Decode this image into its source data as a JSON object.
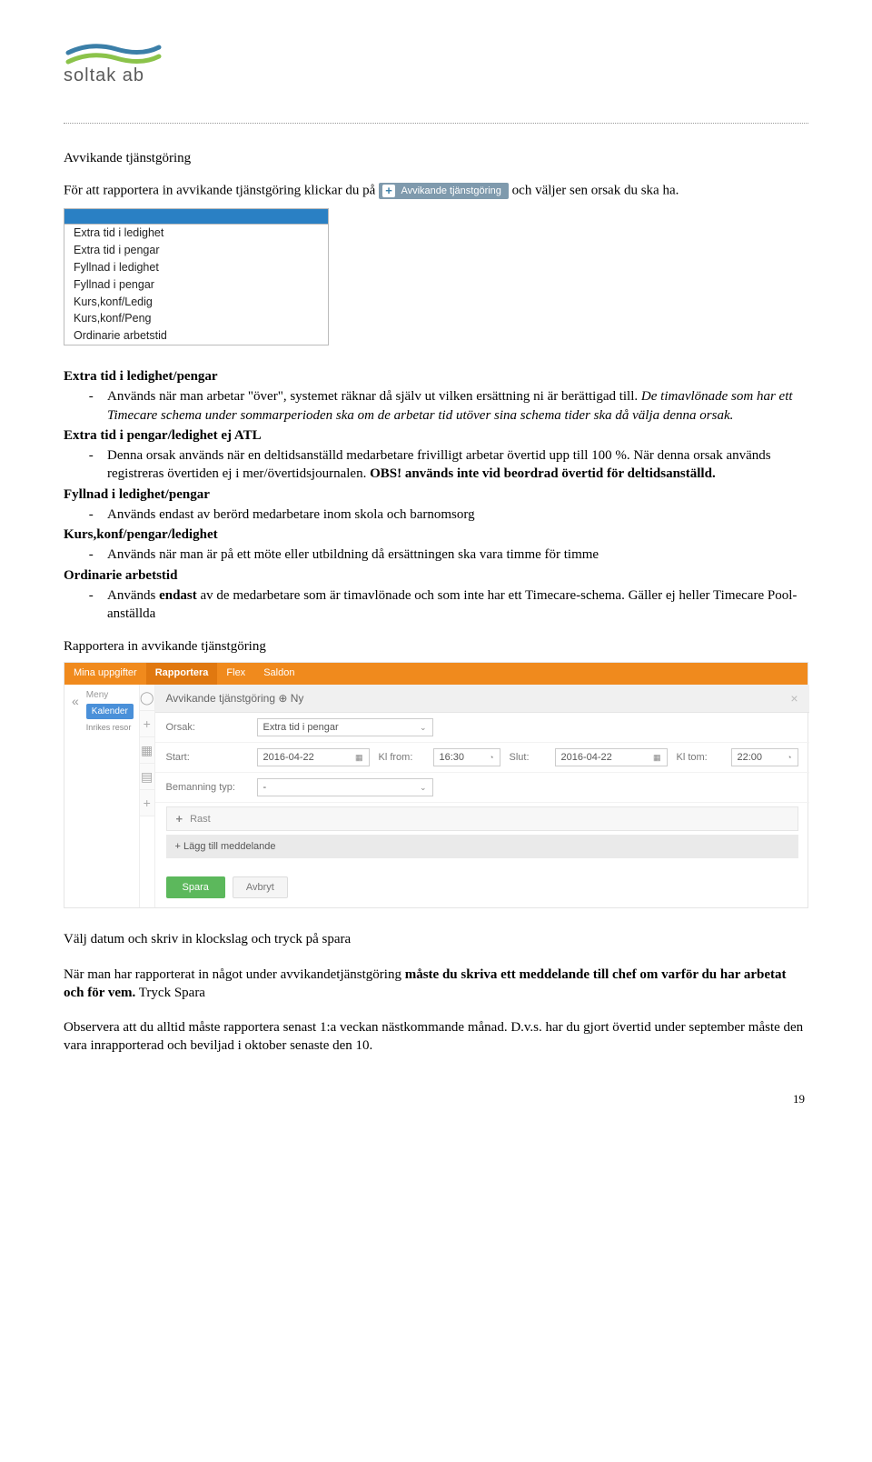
{
  "logo_text": "soltak ab",
  "title": "Avvikande tjänstgöring",
  "intro_prefix": "För att rapportera in avvikande tjänstgöring klickar du på ",
  "intro_suffix": " och väljer sen orsak du ska ha.",
  "badge_label": "Avvikande tjänstgöring",
  "dropdown_options": [
    "Extra tid i ledighet",
    "Extra tid i pengar",
    "Fyllnad i ledighet",
    "Fyllnad i pengar",
    "Kurs,konf/Ledig",
    "Kurs,konf/Peng",
    "Ordinarie arbetstid"
  ],
  "sections": {
    "extra_tid_heading": "Extra tid i ledighet/pengar",
    "extra_tid_bullet": "Används när man arbetar \"över\", systemet räknar då själv ut vilken ersättning ni är berättigad till. ",
    "extra_tid_italic": "De timavlönade som har ett Timecare schema under sommarperioden ska om de arbetar tid utöver sina schema tider ska då välja denna orsak.",
    "pengar_heading": "Extra tid i pengar/ledighet ej ATL",
    "pengar_bullet_1": "Denna orsak används när en deltidsanställd medarbetare frivilligt arbetar övertid upp till 100 %. När denna orsak används registreras övertiden ej i mer/övertidsjournalen. ",
    "pengar_obs": "OBS! används inte vid beordrad övertid för deltidsanställd.",
    "fyllnad_heading": "Fyllnad i ledighet/pengar",
    "fyllnad_bullet": "Används endast av berörd medarbetare inom skola och barnomsorg",
    "kurs_heading": "Kurs,konf/pengar/ledighet",
    "kurs_bullet": "Används när man är på ett möte eller utbildning då ersättningen ska vara timme för timme",
    "ord_heading": "Ordinarie arbetstid",
    "ord_bullet_pre": "Används ",
    "ord_bullet_bold": "endast",
    "ord_bullet_post": " av de medarbetare som är timavlönade och som inte har ett Timecare-schema. Gäller ej heller Timecare Pool-anställda"
  },
  "rapportera_heading": "Rapportera in avvikande tjänstgöring",
  "form": {
    "tabs": [
      "Mina uppgifter",
      "Rapportera",
      "Flex",
      "Saldon"
    ],
    "left_menu": "Meny",
    "kalender": "Kalender",
    "inrikes": "Inrikes resor",
    "header": "Avvikande tjänstgöring ⊕  Ny",
    "orsak_lbl": "Orsak:",
    "orsak_val": "Extra tid i pengar",
    "start_lbl": "Start:",
    "start_val": "2016-04-22",
    "klfrom_lbl": "Kl from:",
    "klfrom_val": "16:30",
    "slut_lbl": "Slut:",
    "slut_val": "2016-04-22",
    "kltom_lbl": "Kl tom:",
    "kltom_val": "22:00",
    "bem_lbl": "Bemanning typ:",
    "bem_val": "-",
    "rast": "Rast",
    "lagg": "+  Lägg till meddelande",
    "spara": "Spara",
    "avbryt": "Avbryt"
  },
  "para1": "Välj datum och skriv in klockslag och tryck på spara",
  "para2_pre": "När man har rapporterat in något under avvikandetjänstgöring ",
  "para2_bold": "måste du skriva ett meddelande till chef om varför du har arbetat och för vem.",
  "para2_post": " Tryck Spara",
  "para3": "Observera att du alltid måste rapportera senast 1:a veckan nästkommande månad. D.v.s. har du gjort övertid under september måste den vara inrapporterad och beviljad i oktober senaste den 10.",
  "page_number": "19"
}
